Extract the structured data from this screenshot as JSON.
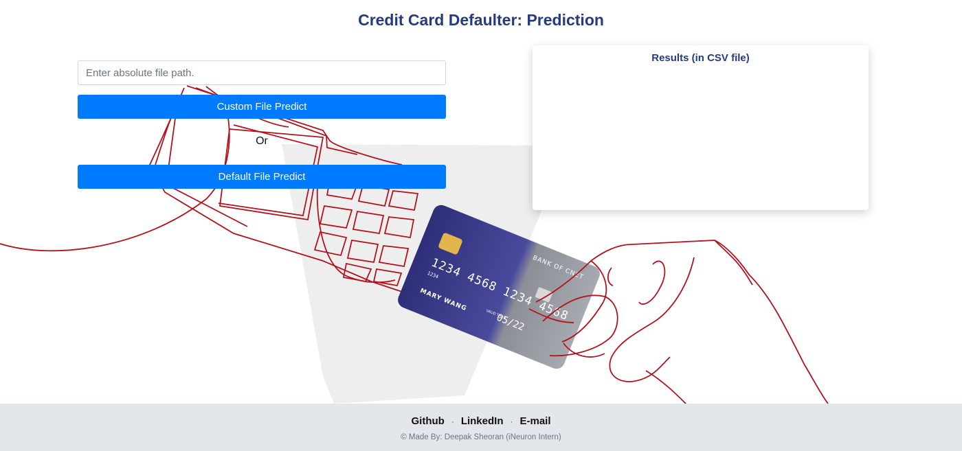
{
  "page": {
    "title": "Credit Card Defaulter: Prediction"
  },
  "form": {
    "path_placeholder": "Enter absolute file path.",
    "path_value": "",
    "custom_button_label": "Custom File Predict",
    "separator_label": "Or",
    "default_button_label": "Default File Predict"
  },
  "results": {
    "title": "Results (in CSV file)"
  },
  "illustration": {
    "card_number": "1234 4568 1234 4568",
    "card_small_number": "1234",
    "card_holder": "MARY WANG",
    "card_bank": "BANK OF CNET",
    "card_valid_label": "VALID THRU",
    "card_expiry": "05/22"
  },
  "footer": {
    "links": [
      "Github",
      "LinkedIn",
      "E-mail"
    ],
    "credit": "© Made By: Deepak Sheoran (iNeuron Intern)"
  },
  "colors": {
    "title": "#253b80",
    "button": "#007bff",
    "footer_bg": "#e3e7eb",
    "line_art": "#b3121c",
    "card_left": "#3e3f8e",
    "card_right": "#8d8f97"
  }
}
